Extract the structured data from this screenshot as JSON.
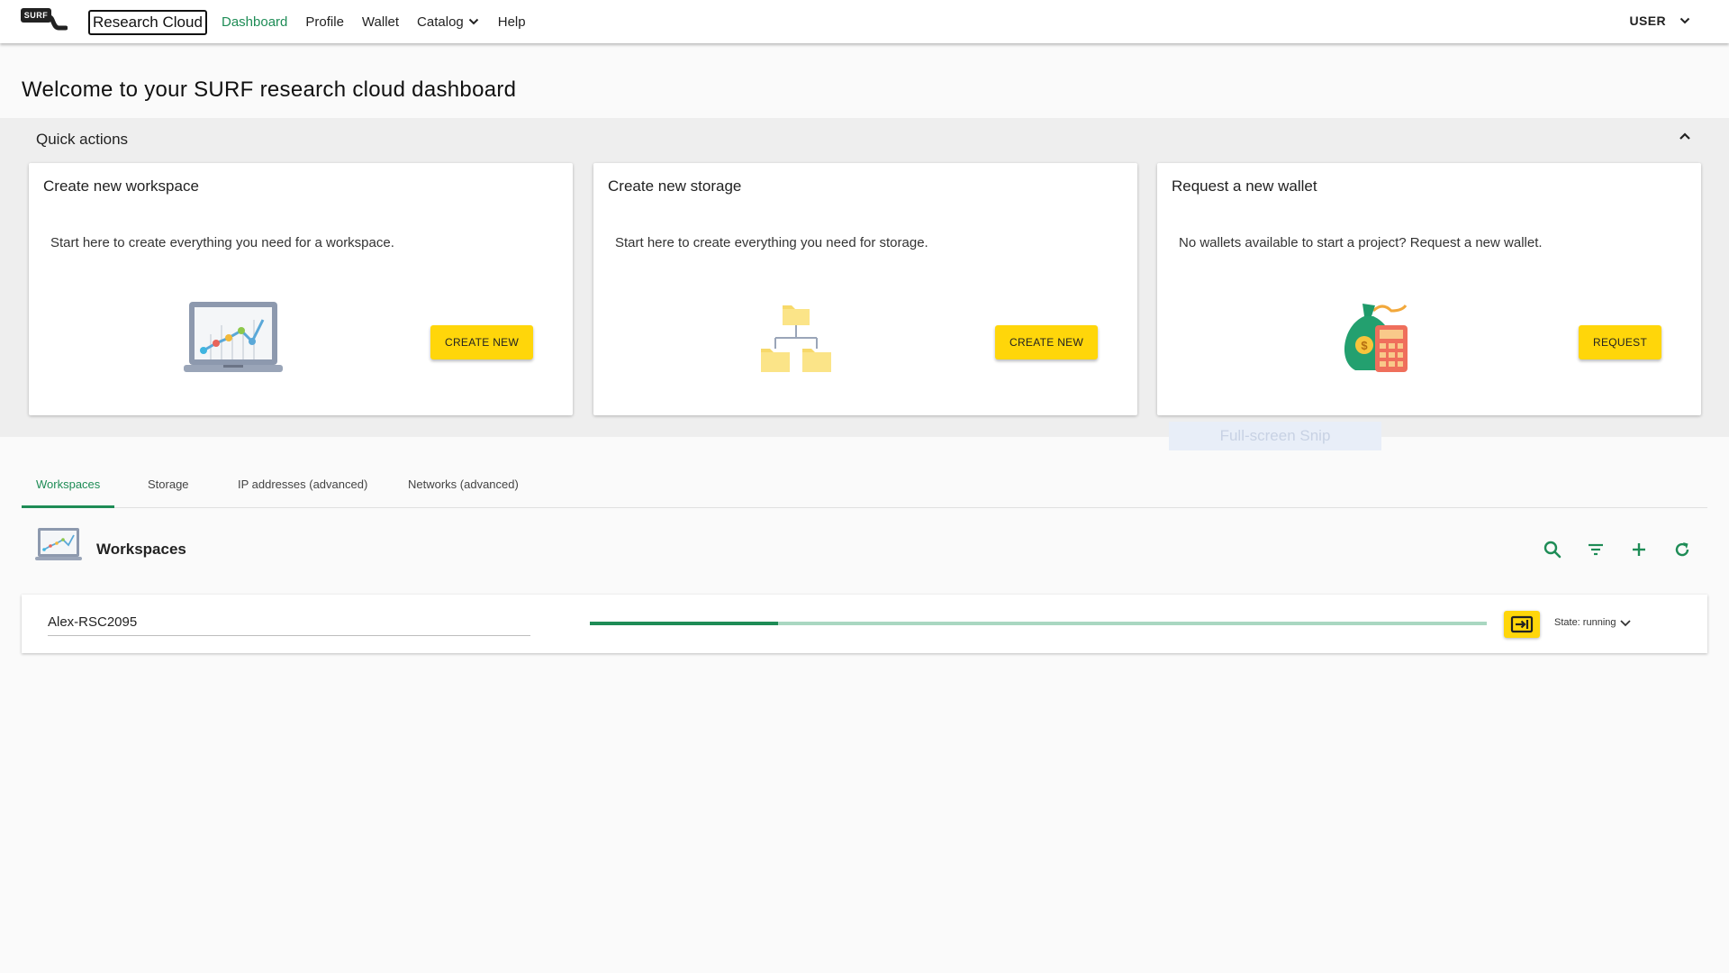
{
  "app": {
    "logo_text": "SURF",
    "brand": "Research Cloud"
  },
  "nav": {
    "items": [
      "Dashboard",
      "Profile",
      "Wallet",
      "Catalog",
      "Help"
    ],
    "active": "Dashboard",
    "user_label": "USER"
  },
  "page": {
    "title": "Welcome to your SURF research cloud dashboard"
  },
  "quick_actions": {
    "title": "Quick actions",
    "cards": [
      {
        "title": "Create new workspace",
        "description": "Start here to create everything you need for a workspace.",
        "button": "CREATE NEW",
        "icon": "laptop-chart-icon"
      },
      {
        "title": "Create new storage",
        "description": "Start here to create everything you need for storage.",
        "button": "CREATE NEW",
        "icon": "folder-tree-icon"
      },
      {
        "title": "Request a new wallet",
        "description": "No wallets available to start a project? Request a new wallet.",
        "button": "REQUEST",
        "icon": "money-bag-calculator-icon"
      }
    ]
  },
  "overlay": {
    "snip_text": "Full-screen Snip"
  },
  "tabs": {
    "items": [
      "Workspaces",
      "Storage",
      "IP addresses (advanced)",
      "Networks (advanced)"
    ],
    "active": "Workspaces"
  },
  "workspaces": {
    "title": "Workspaces",
    "tools": [
      "search-icon",
      "filter-icon",
      "add-icon",
      "refresh-icon"
    ],
    "rows": [
      {
        "name": "Alex-RSC2095",
        "progress": 0.21,
        "state": "State: running"
      }
    ]
  },
  "colors": {
    "accent": "#1e8c56",
    "button": "#ffd60a"
  }
}
